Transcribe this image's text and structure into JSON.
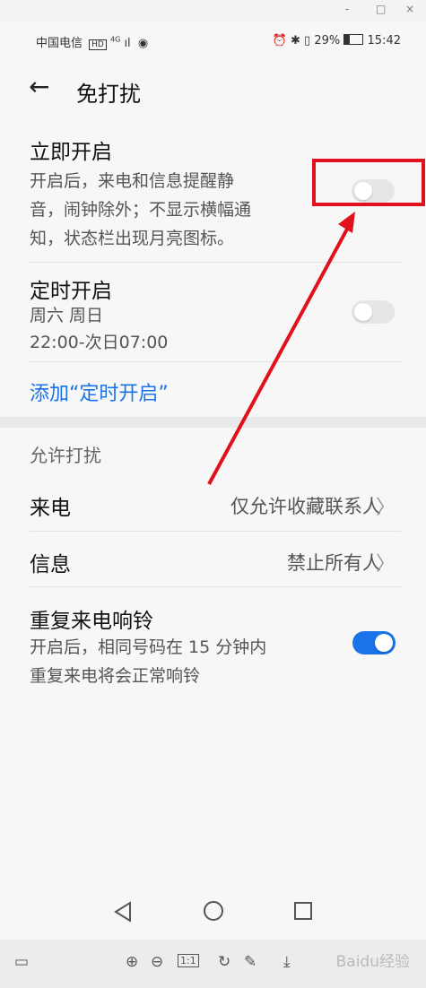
{
  "window": {
    "minimize": "-",
    "maximize": "□",
    "close": "×"
  },
  "status_bar": {
    "carrier": "中国电信",
    "hd": "HD",
    "network": "4G",
    "signal": "ıl",
    "battery": "29%",
    "time": "15:42"
  },
  "header": {
    "back": "←",
    "title": "免打扰"
  },
  "immediate": {
    "title": "立即开启",
    "desc_line1": "开启后，来电和信息提醒静",
    "desc_line2": "音，闹钟除外；不显示横幅通",
    "desc_line3": "知，状态栏出现月亮图标。",
    "enabled": false
  },
  "scheduled": {
    "title": "定时开启",
    "days": "周六 周日",
    "time": "22:00-次日07:00",
    "enabled": false
  },
  "add_schedule": "添加“定时开启”",
  "allow_section": {
    "label": "允许打扰"
  },
  "calls": {
    "label": "来电",
    "value": "仅允许收藏联系人"
  },
  "messages": {
    "label": "信息",
    "value": "禁止所有人"
  },
  "repeat_calls": {
    "title": "重复来电响铃",
    "desc_line1": "开启后，相同号码在 15 分钟内",
    "desc_line2": "重复来电将会正常响铃",
    "enabled": true
  },
  "annotation": {
    "color": "#e0101c"
  },
  "accent_color": "#1a73e8",
  "bottom_toolbar": {
    "zoom_reset": "1:1",
    "watermark": "Baidu经验"
  }
}
